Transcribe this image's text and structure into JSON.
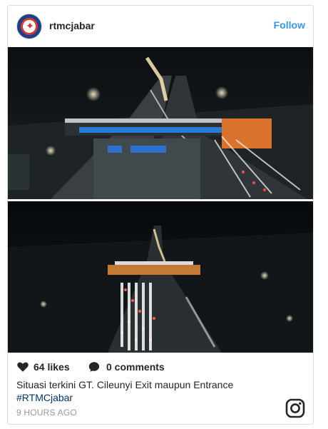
{
  "post": {
    "username": "rtmcjabar",
    "follow_label": "Follow",
    "avatar_icon": "rtmc-logo-icon",
    "likes": "64 likes",
    "comments": "0 comments",
    "caption": "Situasi terkini GT. Cileunyi Exit maupun Entrance",
    "hashtag": "#RTMCjabar",
    "time_ago": "9 HOURS AGO",
    "icons": [
      "heart-icon",
      "comment-icon",
      "instagram-icon"
    ]
  },
  "colors": {
    "accent": "#3897f0",
    "hashtag": "#003569",
    "muted": "#999999",
    "border": "#dbdbdb"
  }
}
